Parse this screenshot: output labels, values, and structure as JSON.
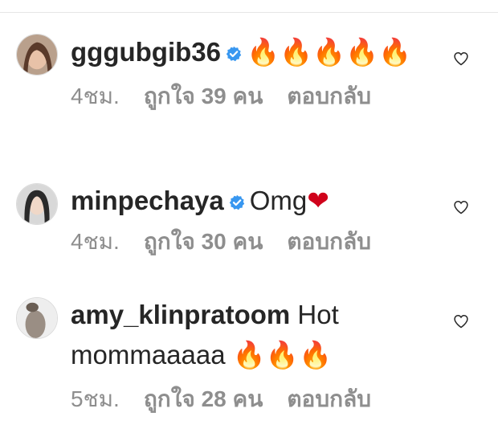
{
  "comments": [
    {
      "username": "gggubgib36",
      "verified": true,
      "text": "🔥🔥🔥🔥🔥",
      "time": "4ชม.",
      "likes": "ถูกใจ 39 คน",
      "reply": "ตอบกลับ"
    },
    {
      "username": "minpechaya",
      "verified": true,
      "text": "Omg",
      "emoji": "❤",
      "time": "4ชม.",
      "likes": "ถูกใจ 30 คน",
      "reply": "ตอบกลับ"
    },
    {
      "username": "amy_klinpratoom",
      "verified": false,
      "text": "Hot mommaaaaa",
      "emoji": "🔥🔥🔥",
      "time": "5ชม.",
      "likes": "ถูกใจ 28 คน",
      "reply": "ตอบกลับ"
    }
  ],
  "icons": {
    "verified": "verified-badge-icon",
    "like": "heart-outline-icon"
  },
  "colors": {
    "username": "#262626",
    "meta": "#8e8e8e",
    "verified": "#3897f0",
    "heart_emoji": "#d0021b"
  }
}
